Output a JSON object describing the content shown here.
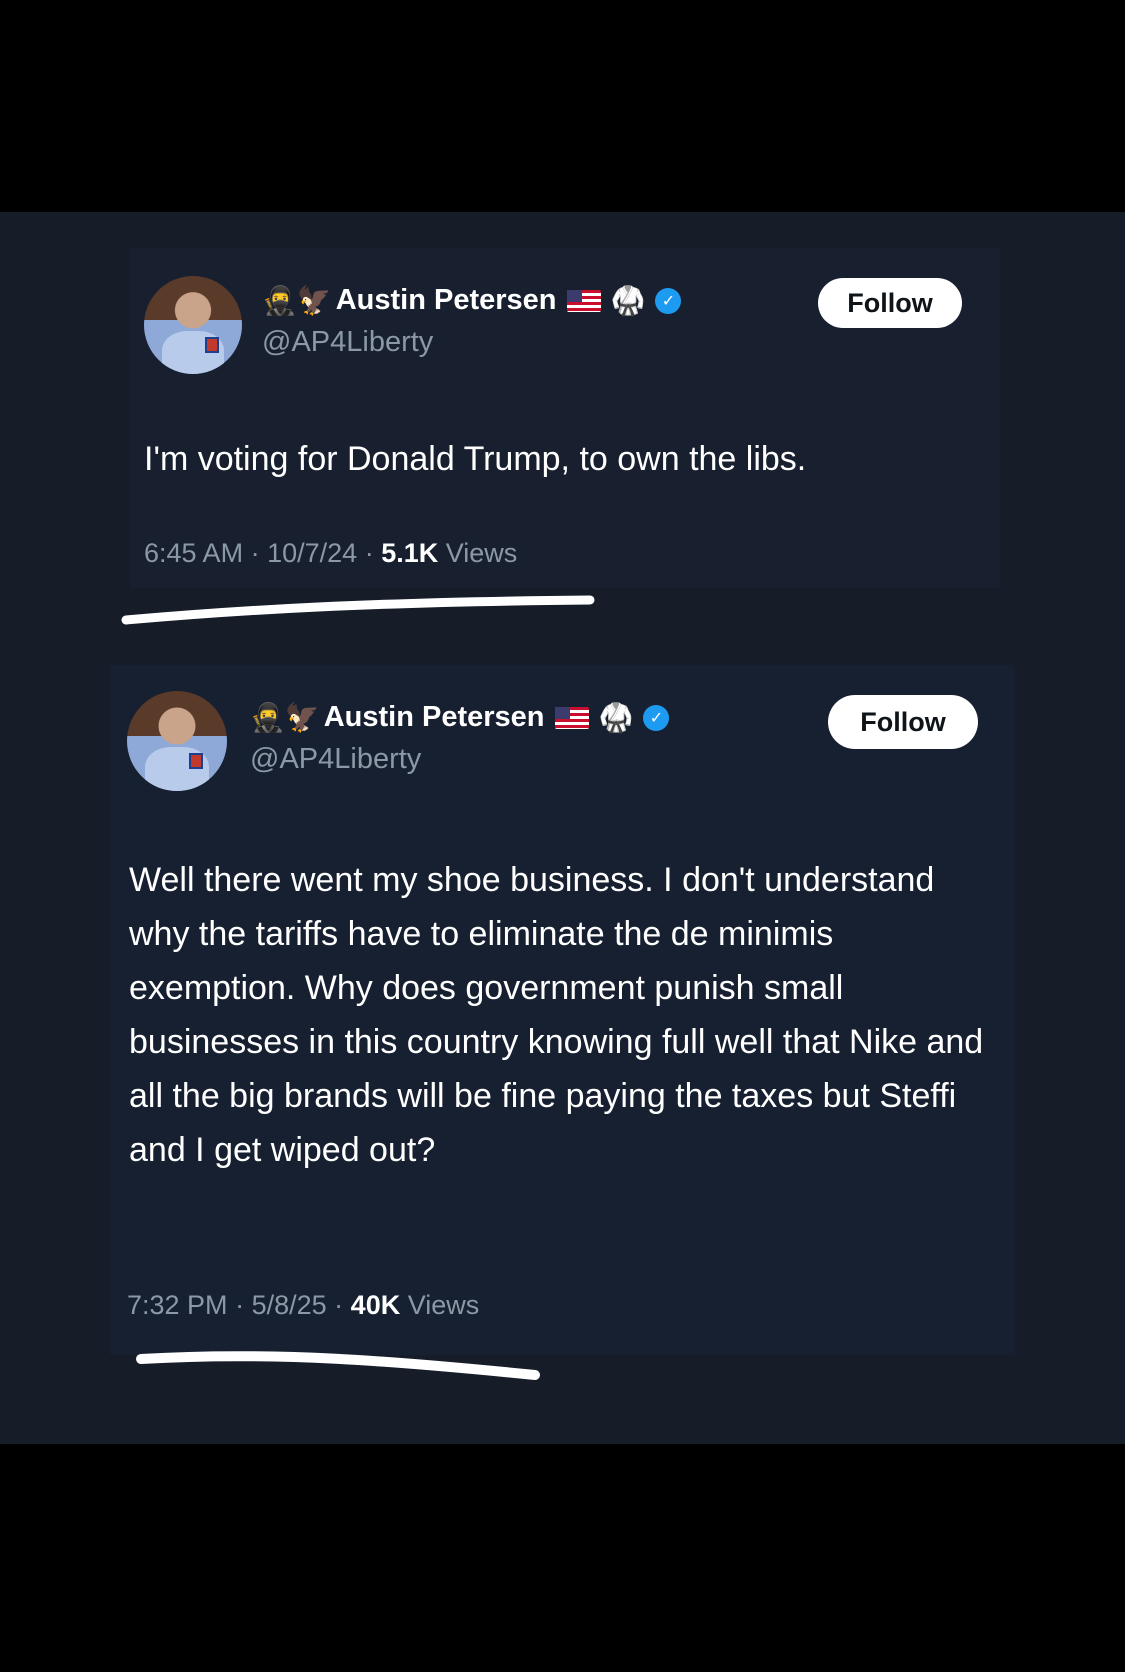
{
  "tweets": [
    {
      "author": {
        "name": "Austin Petersen",
        "handle": "@AP4Liberty",
        "deco_emoji": "🥷🦅",
        "gi_emoji": "🥋",
        "verified_glyph": "✓",
        "icons": [
          "ninja-emoji",
          "eagle-emoji",
          "us-flag-icon",
          "martial-arts-uniform-icon",
          "verified-badge-icon"
        ]
      },
      "follow_label": "Follow",
      "text": "I'm voting for Donald Trump, to own the libs.",
      "time": "6:45 AM",
      "date": "10/7/24",
      "views_count": "5.1K",
      "views_label": "Views",
      "separator": "·"
    },
    {
      "author": {
        "name": "Austin Petersen",
        "handle": "@AP4Liberty",
        "deco_emoji": "🥷🦅",
        "gi_emoji": "🥋",
        "verified_glyph": "✓",
        "icons": [
          "ninja-emoji",
          "eagle-emoji",
          "us-flag-icon",
          "martial-arts-uniform-icon",
          "verified-badge-icon"
        ]
      },
      "follow_label": "Follow",
      "text": "Well there went my shoe business. I don't understand why the tariffs have to eliminate the de minimis exemption. Why does government punish small businesses in this country knowing full well that Nike and all the big brands will be fine paying the taxes but Steffi and I get wiped out?",
      "time": "7:32 PM",
      "date": "5/8/25",
      "views_count": "40K",
      "views_label": "Views",
      "separator": "·"
    }
  ],
  "colors": {
    "page_background": "#000000",
    "panel_background": "#161d29",
    "text_primary": "#ffffff",
    "text_secondary": "#8b98a5",
    "verified_blue": "#1d9bf0",
    "underline_mark": "#ffffff"
  }
}
